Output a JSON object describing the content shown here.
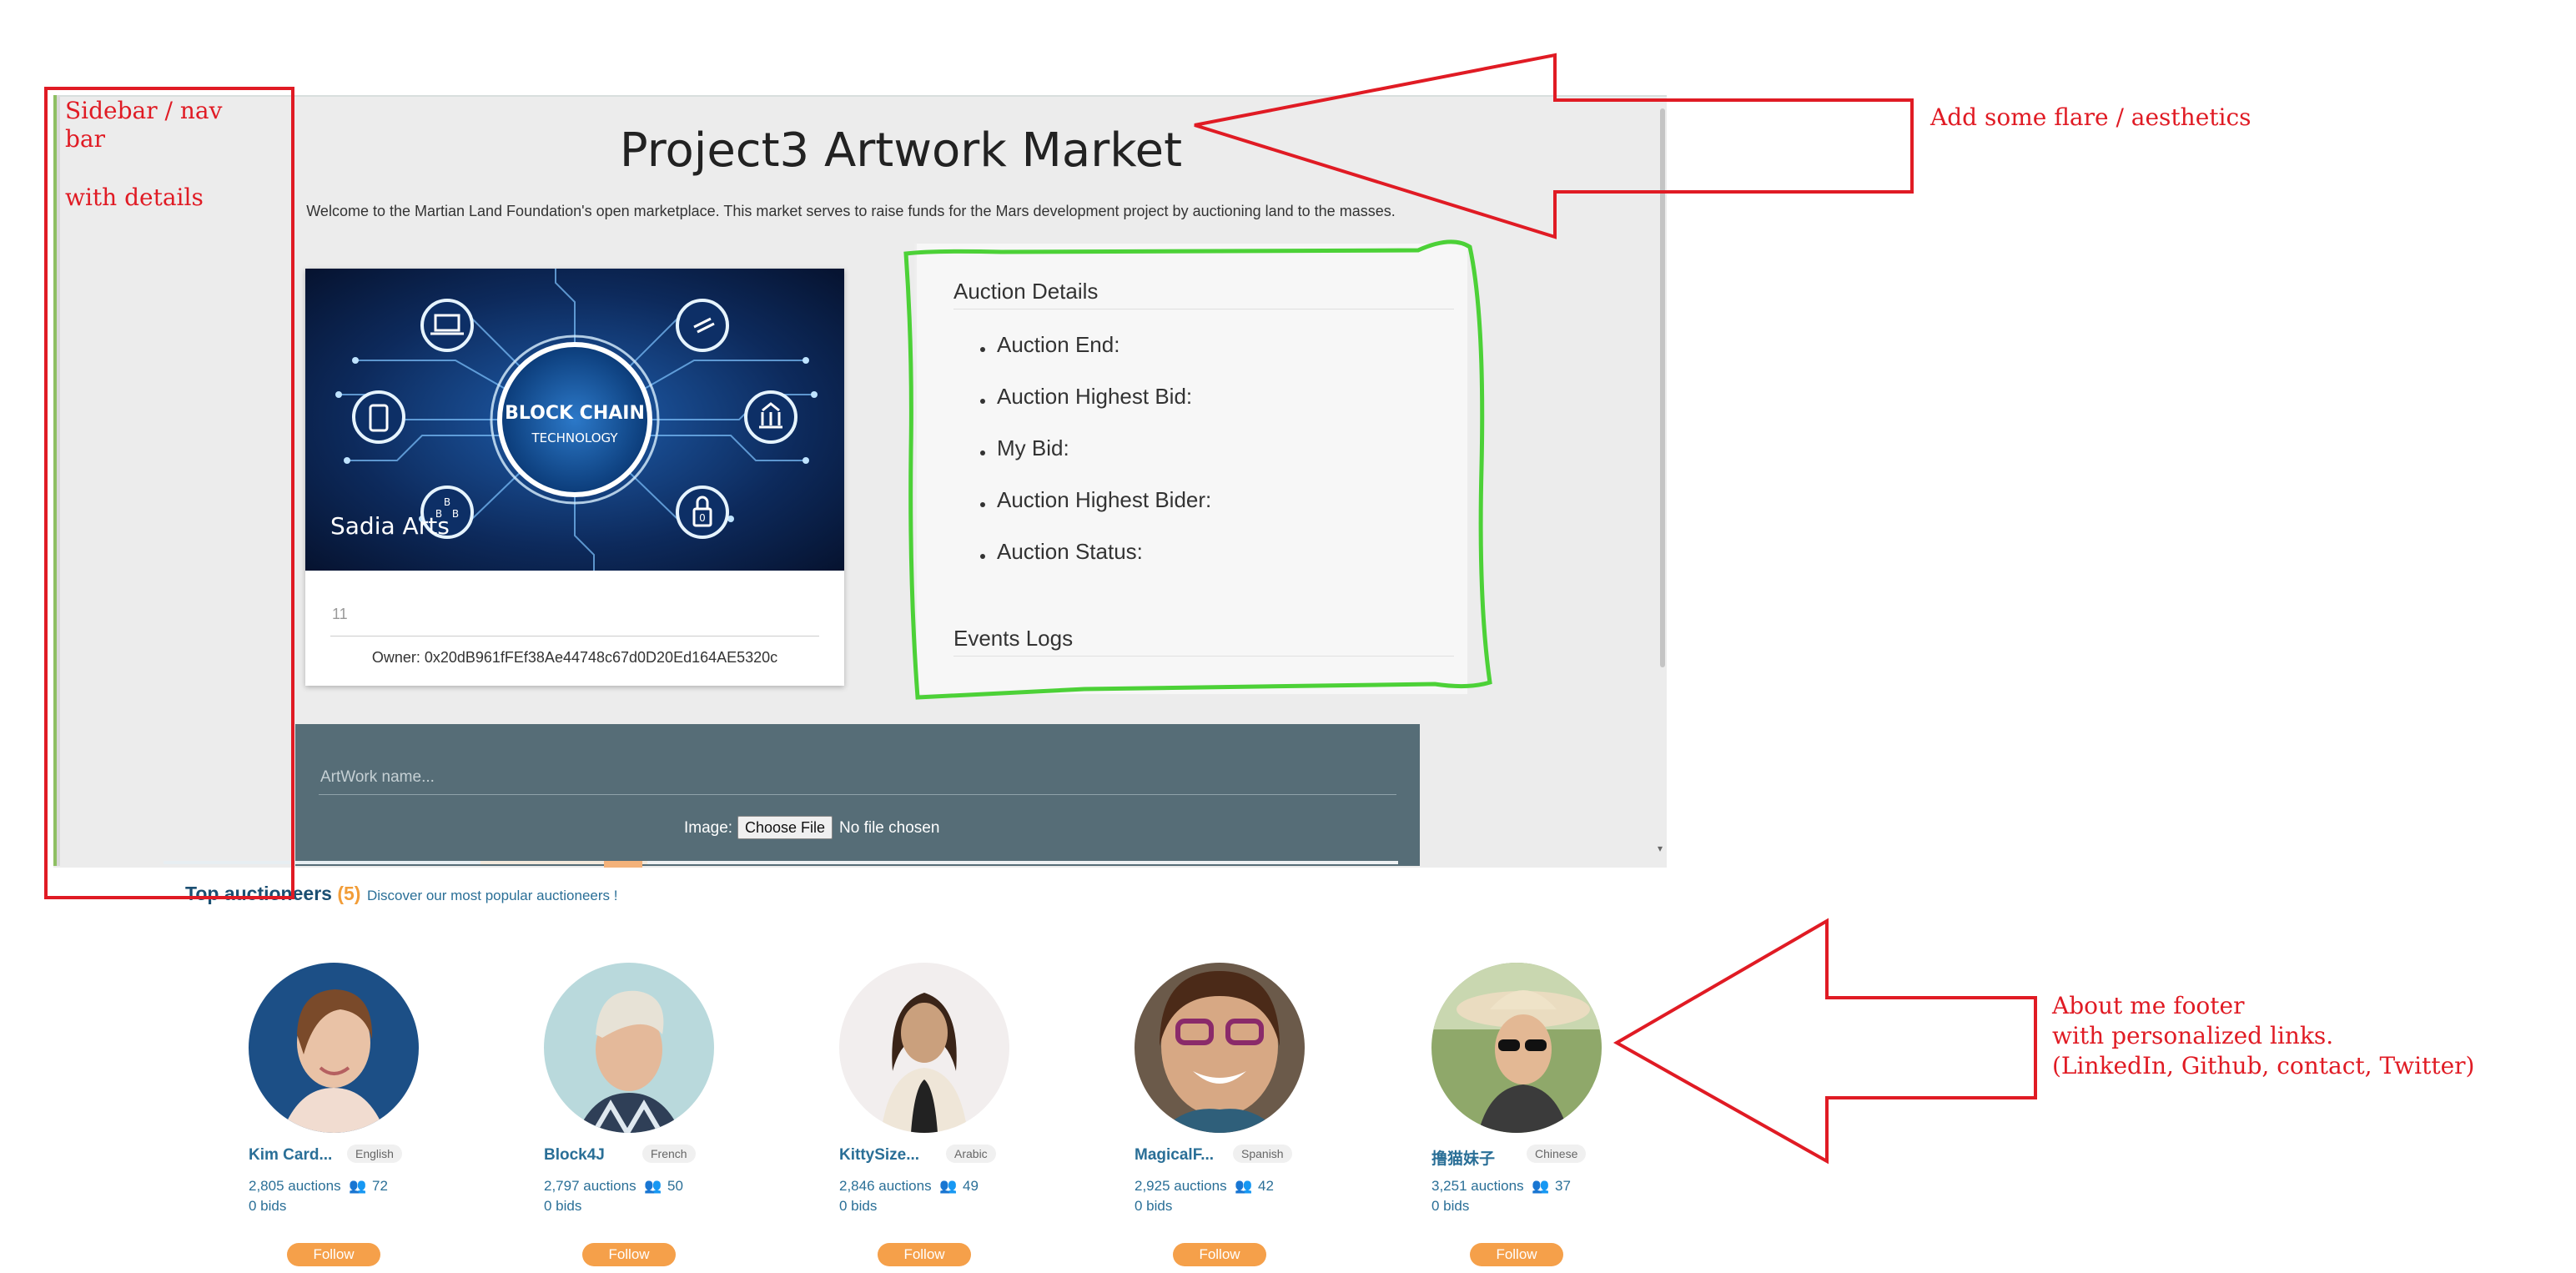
{
  "app": {
    "title": "Project3 Artwork Market",
    "intro": "Welcome to the Martian Land Foundation's open marketplace. This market serves to raise funds for the Mars development project by auctioning land to the masses."
  },
  "artwork": {
    "image_title": "BLOCK CHAIN",
    "image_subtitle": "TECHNOLOGY",
    "caption": "Sadia Arts",
    "number": "11",
    "owner": "Owner: 0x20dB961fFEf38Ae44748c67d0D20Ed164AE5320c"
  },
  "auction": {
    "title": "Auction Details",
    "items": [
      "Auction End:",
      "Auction Highest Bid:",
      "My Bid:",
      "Auction Highest Bider:",
      "Auction Status:"
    ],
    "events_title": "Events Logs"
  },
  "upload": {
    "name_placeholder": "ArtWork name...",
    "image_label": "Image:",
    "choose_file": "Choose File",
    "no_file": "No file chosen"
  },
  "top_auctioneers": {
    "title": "Top auctioneers",
    "count": "(5)",
    "subtitle": "Discover our most popular auctioneers !",
    "follow_label": "Follow",
    "people": [
      {
        "name": "Kim Card...",
        "language": "English",
        "auctions": "2,805 auctions",
        "followers": "72",
        "bids": "0 bids"
      },
      {
        "name": "Block4J",
        "language": "French",
        "auctions": "2,797 auctions",
        "followers": "50",
        "bids": "0 bids"
      },
      {
        "name": "KittySize...",
        "language": "Arabic",
        "auctions": "2,846 auctions",
        "followers": "49",
        "bids": "0 bids"
      },
      {
        "name": "MagicalF...",
        "language": "Spanish",
        "auctions": "2,925 auctions",
        "followers": "42",
        "bids": "0 bids"
      },
      {
        "name": "撸猫妹子",
        "language": "Chinese",
        "auctions": "3,251 auctions",
        "followers": "37",
        "bids": "0 bids"
      }
    ]
  },
  "annotations": {
    "sidebar_line1": "Sidebar / nav",
    "sidebar_line2": "bar",
    "sidebar_line3": "with details",
    "flare": "Add some flare / aesthetics",
    "footer_line1": "About me footer",
    "footer_line2": "with personalized links.",
    "footer_line3": "(LinkedIn, Github, contact, Twitter)"
  },
  "colors": {
    "annotation_red": "#e01b24",
    "highlight_green": "#4cd137",
    "follow_orange": "#f5a04a",
    "form_slate": "#566d77",
    "link_blue": "#2a6f97"
  }
}
